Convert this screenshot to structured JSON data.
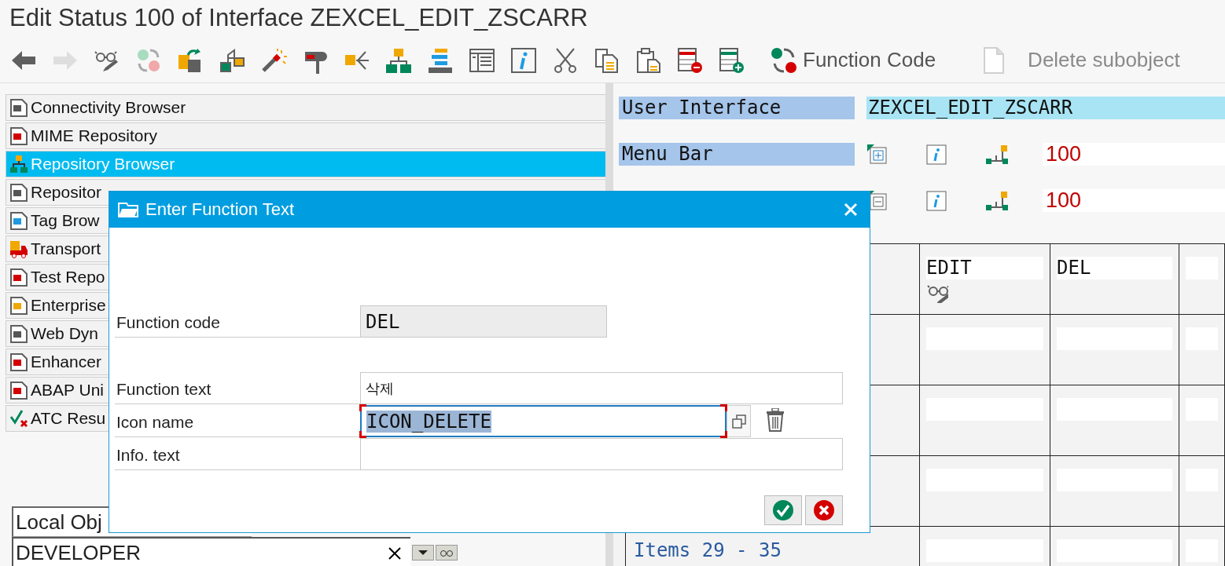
{
  "window": {
    "title": "Edit Status 100 of Interface ZEXCEL_EDIT_ZSCARR"
  },
  "toolbar": {
    "icons": [
      {
        "kind": "back",
        "disabled": false
      },
      {
        "kind": "forward",
        "disabled": true
      },
      {
        "kind": "glasses",
        "disabled": false
      },
      {
        "kind": "cycle",
        "disabled": false
      },
      {
        "kind": "square-arrow",
        "disabled": false
      },
      {
        "kind": "tree",
        "disabled": false
      },
      {
        "kind": "wand",
        "disabled": false
      },
      {
        "kind": "stamp",
        "disabled": false
      },
      {
        "kind": "branch",
        "disabled": false
      },
      {
        "kind": "hierarchy",
        "disabled": false
      },
      {
        "kind": "stack",
        "disabled": false
      },
      {
        "kind": "window",
        "disabled": false
      },
      {
        "kind": "info",
        "disabled": false
      },
      {
        "kind": "scissors",
        "disabled": false
      },
      {
        "kind": "copy",
        "disabled": false
      },
      {
        "kind": "clipboard",
        "disabled": false
      },
      {
        "kind": "row-minus",
        "disabled": false
      },
      {
        "kind": "row-plus",
        "disabled": false
      }
    ],
    "buttons": [
      {
        "kind": "function-code",
        "label": "Function Code",
        "disabled": false
      },
      {
        "kind": "delete",
        "label": "Delete subobject",
        "disabled": true
      }
    ]
  },
  "sidebar": {
    "items": [
      {
        "label": "Connectivity Browser",
        "selected": false
      },
      {
        "label": "MIME Repository",
        "selected": false
      },
      {
        "label": "Repository Browser",
        "selected": true
      },
      {
        "label": "Repositor",
        "selected": false
      },
      {
        "label": "Tag Brow",
        "selected": false
      },
      {
        "label": "Transport",
        "selected": false
      },
      {
        "label": "Test Repo",
        "selected": false
      },
      {
        "label": "Enterprise",
        "selected": false
      },
      {
        "label": "Web Dyn",
        "selected": false
      },
      {
        "label": "Enhancer",
        "selected": false
      },
      {
        "label": "ABAP Uni",
        "selected": false
      },
      {
        "label": "ATC Resu",
        "selected": false
      }
    ]
  },
  "local_objects": {
    "label": "Local Obj",
    "value": "DEVELOPER"
  },
  "interface": {
    "label": "User Interface",
    "value": "ZEXCEL_EDIT_ZSCARR"
  },
  "bars": [
    {
      "label": "Menu Bar",
      "kind": "add",
      "number": "100"
    },
    {
      "kind": "remove",
      "number": "100"
    }
  ],
  "functions": {
    "columns": [
      {
        "code": "EDIT"
      },
      {
        "code": "DEL"
      }
    ],
    "items_label": "Items 29 - 35"
  },
  "dialog": {
    "title": "Enter Function Text",
    "fields": [
      {
        "label": "Function code",
        "value": "DEL",
        "kind": "readonly"
      },
      {
        "label": "Function text",
        "value": "삭제",
        "kind": "text"
      },
      {
        "label": "Icon name",
        "value": "ICON_DELETE",
        "kind": "icon",
        "selected": true
      },
      {
        "label": "Info. text",
        "kind": "text"
      }
    ],
    "buttons": [
      {
        "kind": "ok"
      },
      {
        "kind": "cancel"
      }
    ]
  }
}
